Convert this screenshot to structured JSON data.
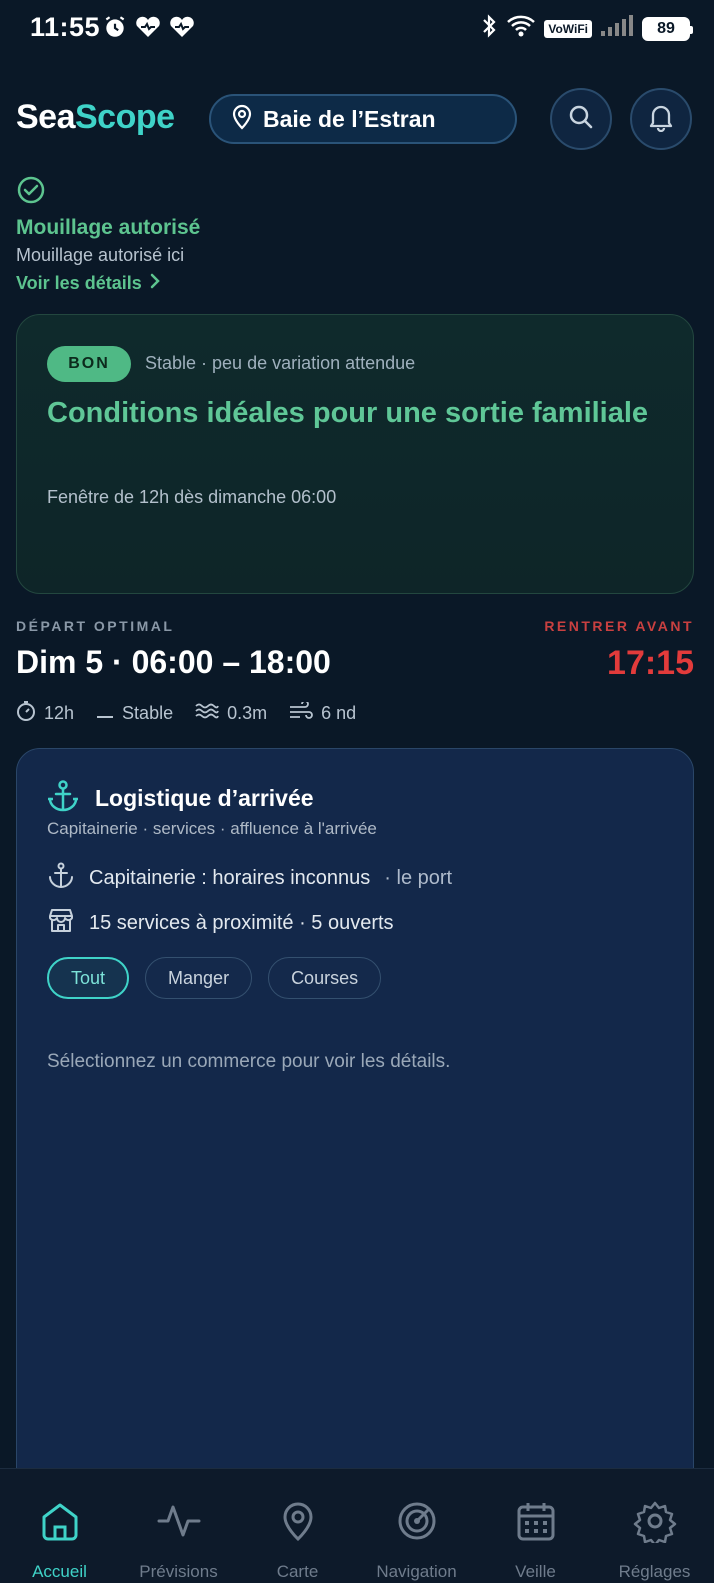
{
  "status_bar": {
    "time": "11:55",
    "network": "VoWiFi",
    "battery": "89"
  },
  "header": {
    "logo_part1": "Sea",
    "logo_part2": "Scope",
    "location": "Baie de l’Estran"
  },
  "mooring": {
    "title": "Mouillage autorisé",
    "subtitle": "Mouillage autorisé ici",
    "link": "Voir les détails"
  },
  "conditions": {
    "badge": "BON",
    "stability": "Stable · peu de variation attendue",
    "title": "Conditions idéales pour une sortie familiale",
    "window": "Fenêtre de 12h dès dimanche 06:00"
  },
  "departure": {
    "label": "DÉPART OPTIMAL",
    "time": "Dim 5 · 06:00 – 18:00",
    "return_label": "RENTRER AVANT",
    "return_time": "17:15",
    "duration": "12h",
    "trend": "Stable",
    "wave": "0.3m",
    "wind": "6 nd"
  },
  "logistics": {
    "title": "Logistique d’arrivée",
    "subtitle": "Capitainerie · services · affluence à l'arrivée",
    "harbour": "Capitainerie : horaires inconnus",
    "harbour_extra": "· le port",
    "services": "15 services à proximité · 5 ouverts",
    "chips": [
      "Tout",
      "Manger",
      "Courses"
    ],
    "hint": "Sélectionnez un commerce pour voir les détails."
  },
  "nav": {
    "items": [
      "Accueil",
      "Prévisions",
      "Carte",
      "Navigation",
      "Veille",
      "Réglages"
    ],
    "active": "Accueil"
  },
  "colors": {
    "accent": "#3fd3c8",
    "good": "#5dc48f",
    "warning": "#e23b3b",
    "background": "#0a1827"
  }
}
